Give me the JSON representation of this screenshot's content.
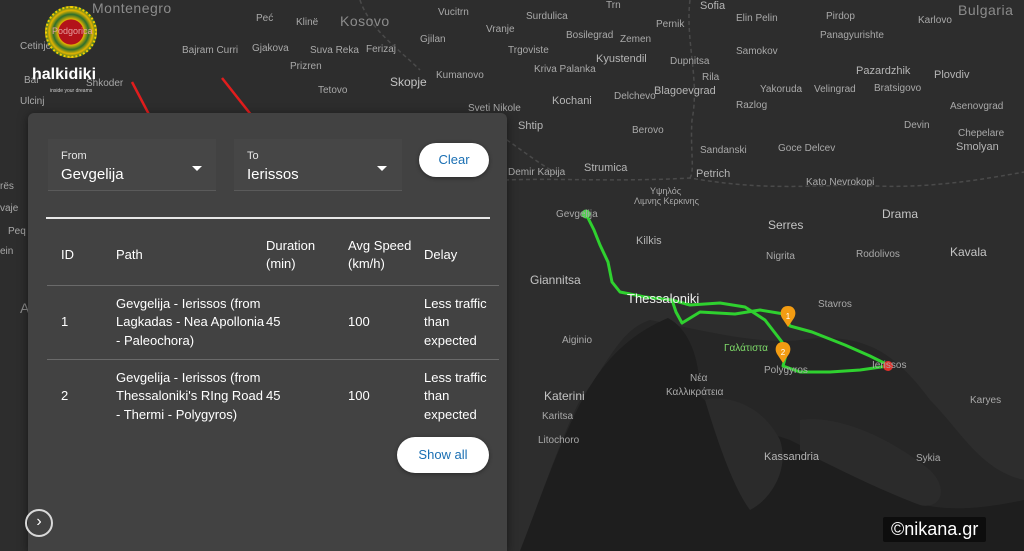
{
  "logo": {
    "title": "halkidiki",
    "tagline": "inside your dreams",
    "overlay_text": "Podgorica"
  },
  "panel": {
    "from": {
      "label": "From",
      "value": "Gevgelija"
    },
    "to": {
      "label": "To",
      "value": "Ierissos"
    },
    "clear_label": "Clear",
    "show_all_label": "Show all",
    "columns": [
      "ID",
      "Path",
      "Duration (min)",
      "Avg Speed (km/h)",
      "Delay"
    ],
    "routes": [
      {
        "id": "1",
        "path": "Gevgelija - Ierissos (from Lagkadas - Nea Apollonia - Paleochora)",
        "duration": "45",
        "avg_speed": "100",
        "delay": "Less traffic than expected"
      },
      {
        "id": "2",
        "path": "Gevgelija - Ierissos (from Thessaloniki's RIng Road - Thermi - Polygyros)",
        "duration": "45",
        "avg_speed": "100",
        "delay": "Less traffic than expected"
      }
    ]
  },
  "expand_icon": "chevron-right-icon",
  "watermark": "©nikana.gr",
  "map": {
    "countries": [
      "Montenegro",
      "Kosovo",
      "Bulgaria"
    ],
    "places": {
      "pec": "Peć",
      "kline": "Klinë",
      "vucitrn": "Vucitrn",
      "surdulica": "Surdulica",
      "trn": "Trn",
      "sofia": "Sofia",
      "pernik": "Pernik",
      "elin_pelin": "Elin Pelin",
      "pirdop": "Pirdop",
      "karlovo": "Karlovo",
      "bajram_curri": "Bajram Curri",
      "gjakova": "Gjakova",
      "suva_reka": "Suva Reka",
      "ferizaj": "Ferizaj",
      "gjilan": "Gjilan",
      "vranje": "Vranje",
      "bosilegrad": "Bosilegrad",
      "zemen": "Zemen",
      "samokov": "Samokov",
      "panagyurishte": "Panagyurishte",
      "cetinje": "Cetinje",
      "trgoviste": "Trgoviste",
      "kyustendil": "Kyustendil",
      "dupnitsa": "Dupnitsa",
      "rila": "Rila",
      "pazardzhik": "Pazardzhik",
      "plovdiv": "Plovdiv",
      "prizren": "Prizren",
      "kriva_palanka": "Kriva Palanka",
      "kumanovo": "Kumanovo",
      "skopje": "Skopje",
      "tetovo": "Tetovo",
      "delchevo": "Delchevo",
      "blagoevgrad": "Blagoevgrad",
      "yakoruda": "Yakoruda",
      "velingrad": "Velingrad",
      "bratsigovo": "Bratsigovo",
      "asenovgrad": "Asenovgrad",
      "kochani": "Kochani",
      "razlog": "Razlog",
      "sveti_nikole": "Sveti Nikole",
      "shtip": "Shtip",
      "berovo": "Berovo",
      "devin": "Devin",
      "chepelare": "Chepelare",
      "bar": "Bar",
      "ulcinj": "Ulcinj",
      "shkoder": "Shkoder",
      "sandanski": "Sandanski",
      "goce_delcev": "Goce Delcev",
      "smolyan": "Smolyan",
      "strumica": "Strumica",
      "demir_kapija": "Demir Kapija",
      "petrich": "Petrich",
      "kato_nevrokopi": "Kato Nevrokopi",
      "ypsilos": "Υψηλός",
      "limnis_kerkinis": "Λιμνης Κερκινης",
      "drama": "Drama",
      "gevgelija": "Gevgelija",
      "kilkis": "Kilkis",
      "serres": "Serres",
      "kavala": "Kavala",
      "nigrita": "Nigrita",
      "rodolivos": "Rodolivos",
      "giannitsa": "Giannitsa",
      "thessaloniki": "Thessaloniki",
      "stavros": "Stavros",
      "aiginio": "Aiginio",
      "galatista": "Γαλάτιστα",
      "polygyros": "Polygyros",
      "ierissos": "Ierissos",
      "nea": "Νέα",
      "kallikrateia": "Καλλικράτεια",
      "karyes": "Karyes",
      "katerini": "Katerini",
      "karitsa": "Karitsa",
      "litochoro": "Litochoro",
      "kassandria": "Kassandria",
      "sykia": "Sykia",
      "left_res": "rës",
      "left_vaje": "vaje",
      "left_peq": "Peq",
      "left_ein": "ein",
      "left_a": "A"
    }
  },
  "colors": {
    "panel_bg": "#424242",
    "map_bg": "#262626",
    "route_green": "#2fd12f",
    "marker_orange": "#f39c12",
    "end_red": "#e0302a",
    "button_text": "#1a6fb3",
    "arrow_red": "#e11d1d"
  }
}
